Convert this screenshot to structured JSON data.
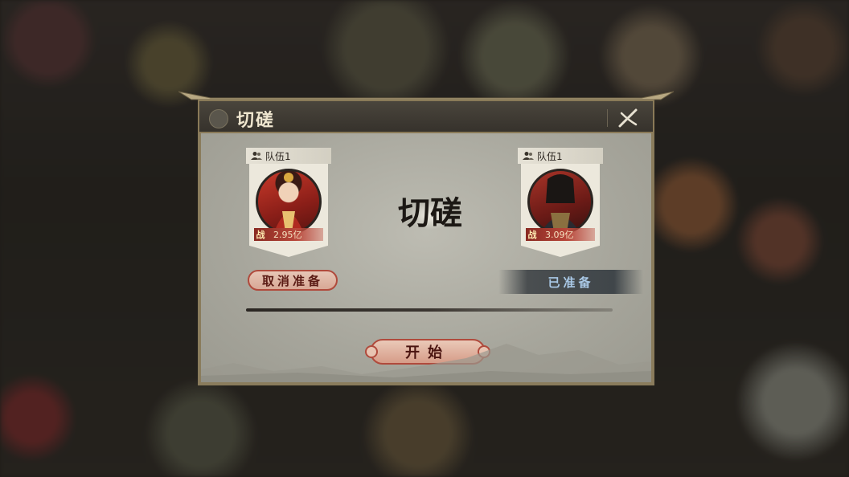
{
  "dialog": {
    "title": "切磋",
    "center_title": "切磋"
  },
  "teams": [
    {
      "label": "队伍1",
      "power_glyph": "战",
      "power": "2.95亿",
      "portrait": "red-robed-female-general"
    },
    {
      "label": "队伍1",
      "power_glyph": "战",
      "power": "3.09亿",
      "portrait": "armored-male-general"
    }
  ],
  "buttons": {
    "cancel_ready": "取消准备",
    "ready_status": "已准备",
    "start": "开始"
  },
  "colors": {
    "frame": "#8a7c5c",
    "title_bar": "#3f3a33",
    "panel": "#b0afa5",
    "accent_red": "#b04a3c",
    "ready_text": "#a9c8e6"
  },
  "icons": [
    "close-icon",
    "team-icon",
    "power-icon"
  ]
}
